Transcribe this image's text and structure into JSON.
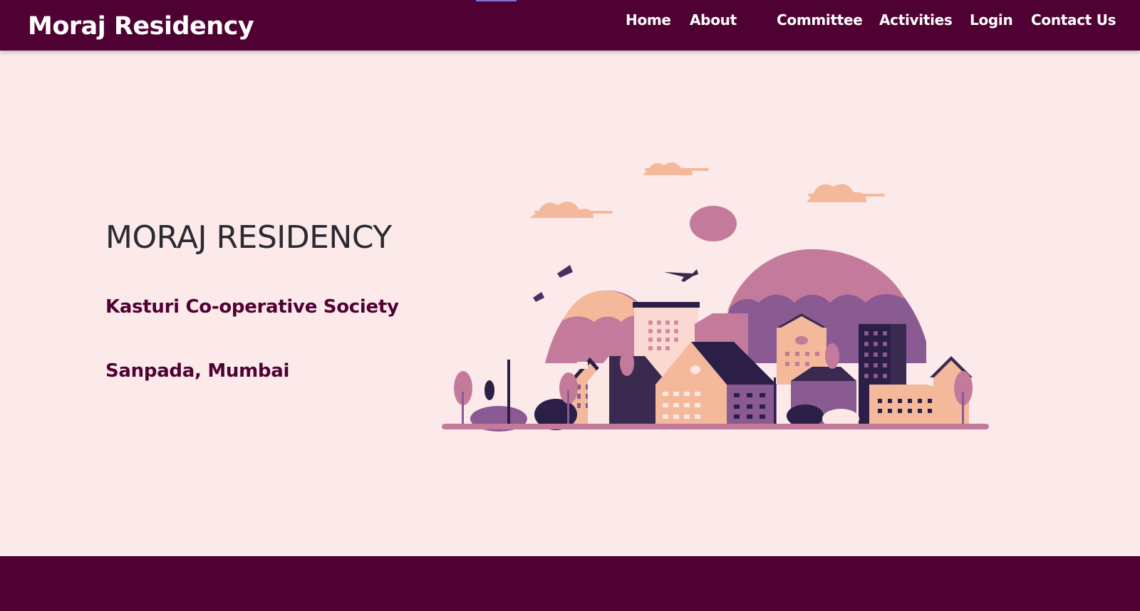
{
  "header": {
    "brand": "Moraj Residency",
    "nav": [
      {
        "label": "Home"
      },
      {
        "label": "About"
      },
      {
        "label": "Committee"
      },
      {
        "label": "Activities"
      },
      {
        "label": "Login"
      },
      {
        "label": "Contact Us"
      }
    ]
  },
  "hero": {
    "title": "MORAJ RESIDENCY",
    "society": "Kasturi Co-operative Society",
    "location": "Sanpada, Mumbai",
    "illustration": "city-skyline-illustration"
  },
  "colors": {
    "brand": "#4f0133",
    "background": "#fce9e9",
    "accent_peach": "#f3b99a",
    "accent_mauve": "#c47a9a",
    "accent_purple": "#8a5a93",
    "dark_navy": "#2b1f47"
  }
}
